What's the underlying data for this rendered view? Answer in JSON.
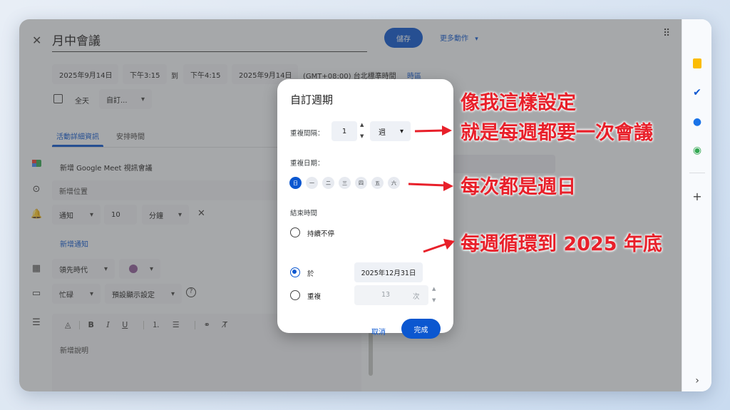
{
  "header": {
    "close_icon": "close-icon",
    "title": "月中會議",
    "save_label": "儲存",
    "more_actions_label": "更多動作"
  },
  "datetime": {
    "start_date": "2025年9月14日",
    "start_time": "下午3:15",
    "to_label": "到",
    "end_time": "下午4:15",
    "end_date": "2025年9月14日",
    "timezone": "(GMT+08:00) 台北標準時間",
    "timezone_link": "時區",
    "all_day_label": "全天",
    "repeat_value": "自訂..."
  },
  "tabs": {
    "details": "活動詳細資訊",
    "schedule": "安排時間"
  },
  "details": {
    "meet_label": "新增 Google Meet 視訊會議",
    "location_placeholder": "新增位置",
    "notify_type": "通知",
    "notify_value": "10",
    "notify_unit": "分鐘",
    "add_notification": "新增通知",
    "calendar_name": "領先時代",
    "busy_status": "忙碌",
    "visibility": "預設顯示設定",
    "description_placeholder": "新增說明"
  },
  "dialog": {
    "title": "自訂週期",
    "interval_label": "重複間隔：",
    "interval_value": "1",
    "interval_unit": "週",
    "repeat_days_label": "重複日期：",
    "days": [
      "日",
      "一",
      "二",
      "三",
      "四",
      "五",
      "六"
    ],
    "selected_day": "日",
    "end_label": "結束時間",
    "end_options": {
      "never": "持續不停",
      "on": "於",
      "after": "重複"
    },
    "end_selected": "on",
    "end_date": "2025年12月31日",
    "occurrences_value": "13",
    "occurrences_unit": "次",
    "cancel_label": "取消",
    "done_label": "完成"
  },
  "annotations": {
    "line1": "像我這樣設定",
    "line2": "就是每週都要一次會議",
    "line3": "每次都是週日",
    "line4": "每週循環到 2025 年底"
  },
  "colors": {
    "accent": "#0b57d0",
    "annotation": "#e8202a",
    "calendar_color": "#8e5b9a"
  }
}
